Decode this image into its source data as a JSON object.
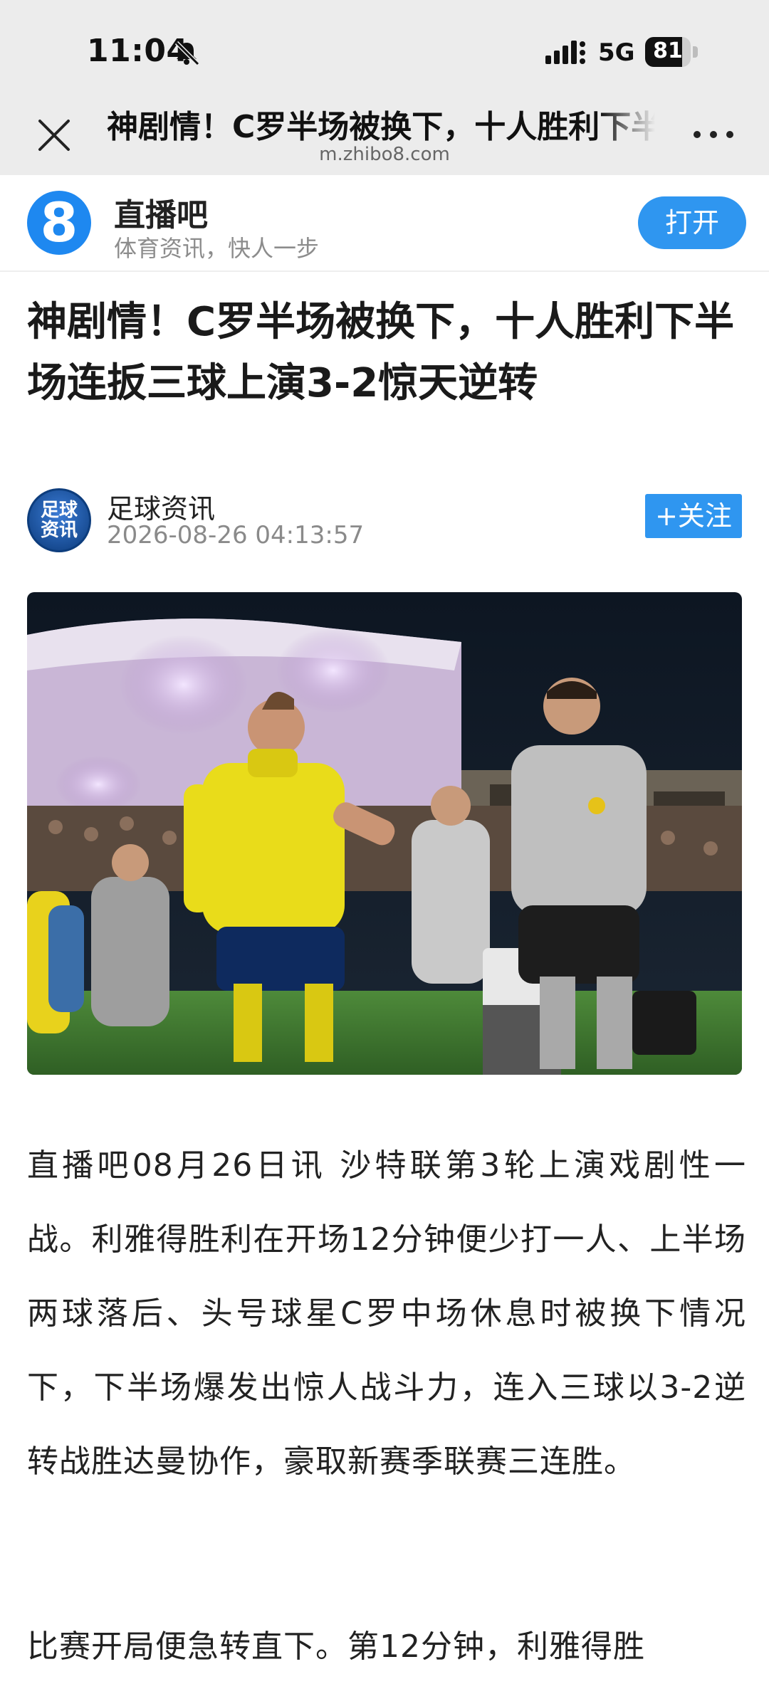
{
  "status_bar": {
    "time": "11:04",
    "network": "5G",
    "battery": "81",
    "battery_level_pct": 81
  },
  "browser": {
    "page_title": "神剧情！C罗半场被换下，十人胜利下半场连扳三球上演3-2惊天逆转",
    "domain": "m.zhibo8.com",
    "close_icon": "close-icon",
    "more_icon": "more-icon"
  },
  "app_banner": {
    "logo_char": "8",
    "app_name": "直播吧",
    "slogan": "体育资讯，快人一步",
    "open_label": "打开",
    "accent": "#2f96f0"
  },
  "article": {
    "headline": "神剧情！C罗半场被换下，十人胜利下半场连扳三球上演3-2惊天逆转",
    "author_avatar_text": "足球资讯",
    "author": "足球资讯",
    "published": "2026-08-26 04:13:57",
    "follow_label": "+关注",
    "paragraph1": "直播吧08月26日讯 沙特联第3轮上演戏剧性一战。利雅得胜利在开场12分钟便少打一人、上半场两球落后、头号球星C罗中场休息时被换下情况下，下半场爆发出惊人战斗力，连入三球以3-2逆转战胜达曼协作，豪取新赛季联赛三连胜。",
    "paragraph2": "比赛开局便急转直下。第12分钟，利雅得胜"
  }
}
